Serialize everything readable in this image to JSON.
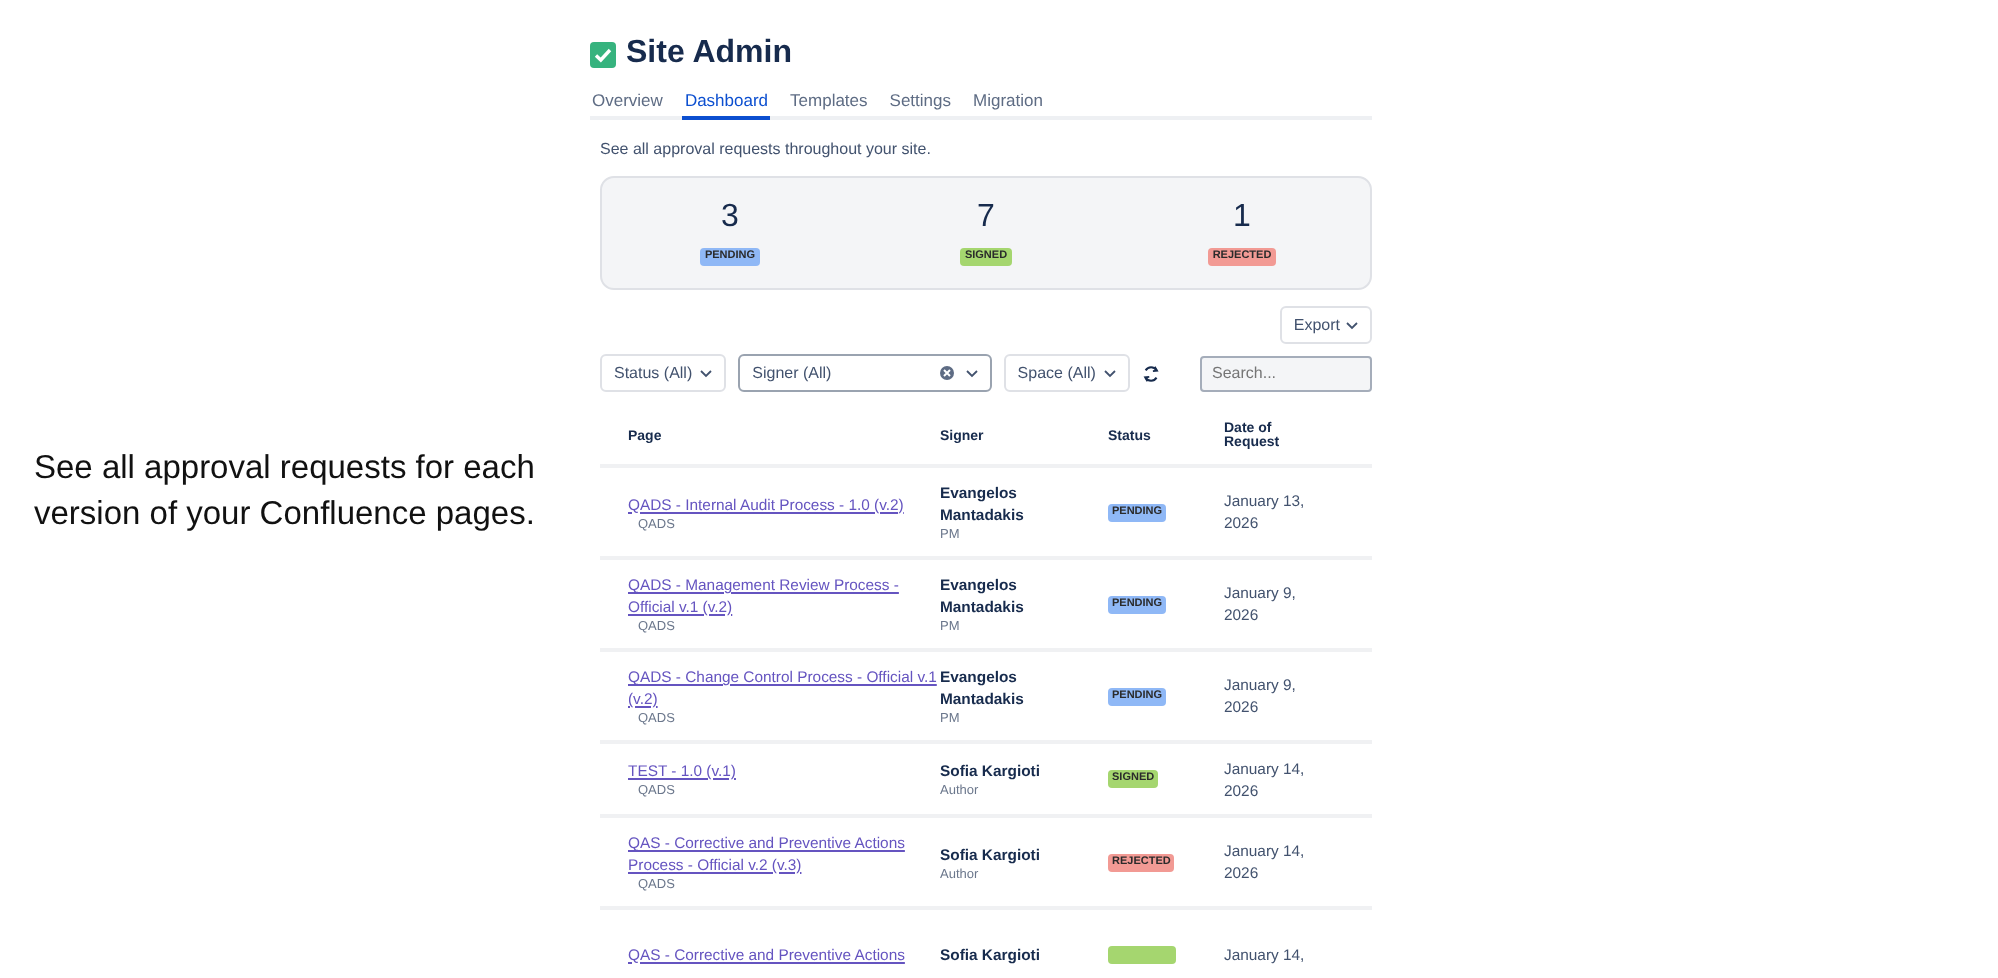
{
  "intro": "See all approval requests for each version of your Confluence pages.",
  "app": {
    "title": "Site Admin"
  },
  "tabs": [
    {
      "label": "Overview",
      "selected": false
    },
    {
      "label": "Dashboard",
      "selected": true
    },
    {
      "label": "Templates",
      "selected": false
    },
    {
      "label": "Settings",
      "selected": false
    },
    {
      "label": "Migration",
      "selected": false
    }
  ],
  "description": "See all approval requests throughout your site.",
  "summary": [
    {
      "count": "3",
      "status": "PENDING",
      "color": "#8fb8f6"
    },
    {
      "count": "7",
      "status": "SIGNED",
      "color": "#a5d66f"
    },
    {
      "count": "1",
      "status": "REJECTED",
      "color": "#f29a94"
    }
  ],
  "export_button": "Export",
  "filters": {
    "status": "Status (All)",
    "signer": "Signer (All)",
    "space": "Space (All)",
    "search_placeholder": "Search..."
  },
  "table": {
    "columns": [
      "Page",
      "Signer",
      "Status",
      "Date of Request"
    ],
    "rows": [
      {
        "page": "QADS - Internal Audit Process - 1.0 (v.2)",
        "space": "QADS",
        "signer": "Evangelos Mantadakis",
        "role": "PM",
        "status": "PENDING",
        "color": "#8fb8f6",
        "date": "January 13, 2026"
      },
      {
        "page": "QADS - Management Review Process - Official v.1 (v.2)",
        "space": "QADS",
        "signer": "Evangelos Mantadakis",
        "role": "PM",
        "status": "PENDING",
        "color": "#8fb8f6",
        "date": "January 9, 2026"
      },
      {
        "page": "QADS - Change Control Process - Official v.1 (v.2)",
        "space": "QADS",
        "signer": "Evangelos Mantadakis",
        "role": "PM",
        "status": "PENDING",
        "color": "#8fb8f6",
        "date": "January 9, 2026"
      },
      {
        "page": "TEST - 1.0 (v.1)",
        "space": "QADS",
        "signer": "Sofia Kargioti",
        "role": "Author",
        "status": "SIGNED",
        "color": "#a5d66f",
        "date": "January 14, 2026"
      },
      {
        "page": "QAS - Corrective and Preventive Actions Process - Official v.2 (v.3)",
        "space": "QADS",
        "signer": "Sofia Kargioti",
        "role": "Author",
        "status": "REJECTED",
        "color": "#f29a94",
        "date": "January 14, 2026"
      },
      {
        "page": "QAS - Corrective and Preventive Actions",
        "signer": "Sofia Kargioti",
        "color": "#a5d66f",
        "date": "January 14,"
      }
    ]
  }
}
